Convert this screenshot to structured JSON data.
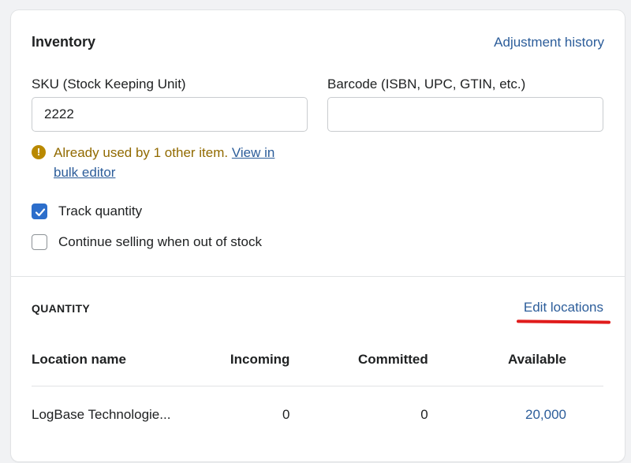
{
  "inventory": {
    "title": "Inventory",
    "adjustment_history": "Adjustment history",
    "sku_label": "SKU (Stock Keeping Unit)",
    "sku_value": "2222",
    "barcode_label": "Barcode (ISBN, UPC, GTIN, etc.)",
    "barcode_value": "",
    "warning_text": "Already used by 1 other item.",
    "warning_link": "View in bulk editor",
    "warning_icon": "alert-icon",
    "track_quantity": {
      "label": "Track quantity",
      "checked": true
    },
    "continue_selling": {
      "label": "Continue selling when out of stock",
      "checked": false
    }
  },
  "quantity": {
    "title": "QUANTITY",
    "edit_locations": "Edit locations",
    "columns": [
      "Location name",
      "Incoming",
      "Committed",
      "Available"
    ],
    "rows": [
      {
        "location": "LogBase Technologie...",
        "incoming": "0",
        "committed": "0",
        "available": "20,000"
      }
    ]
  },
  "colors": {
    "link": "#2c5d9a",
    "accent": "#2c6ecb",
    "warning": "#916a00",
    "annotation": "#e01b1b"
  }
}
